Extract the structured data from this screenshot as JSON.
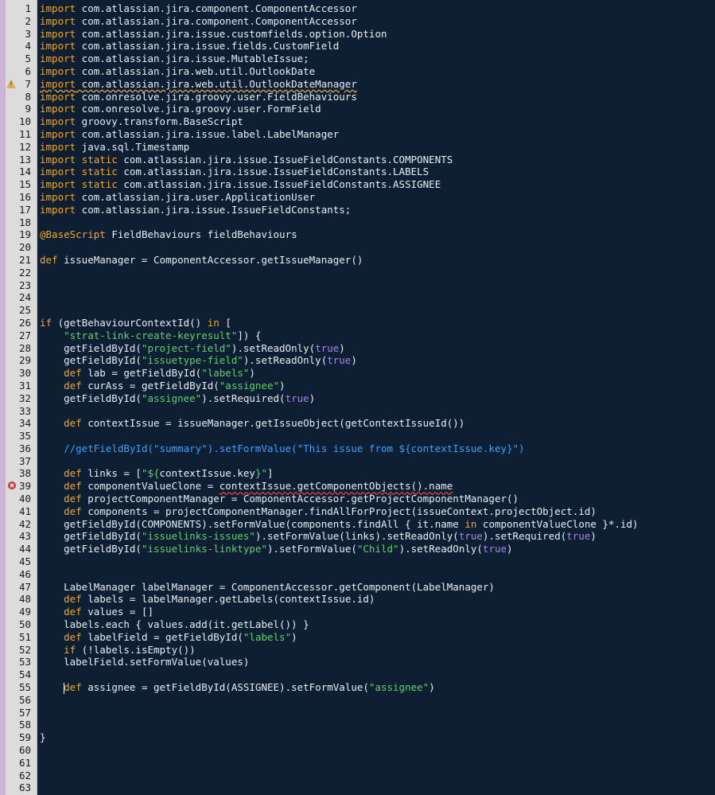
{
  "editor": {
    "background": "#0f1f33",
    "gutter_color": "#dcdcdc",
    "warning_line": 7,
    "error_line": 39,
    "cursor_line": 55
  },
  "lines": [
    {
      "n": "1",
      "t": [
        {
          "c": "kw",
          "s": "import"
        },
        {
          "s": " com.atlassian.jira.component.ComponentAccessor"
        }
      ]
    },
    {
      "n": "2",
      "t": [
        {
          "c": "kw",
          "s": "import"
        },
        {
          "s": " com.atlassian.jira.component.ComponentAccessor"
        }
      ]
    },
    {
      "n": "3",
      "t": [
        {
          "c": "kw",
          "s": "import"
        },
        {
          "s": " com.atlassian.jira.issue.customfields.option.Option"
        }
      ]
    },
    {
      "n": "4",
      "t": [
        {
          "c": "kw",
          "s": "import"
        },
        {
          "s": " com.atlassian.jira.issue.fields.CustomField"
        }
      ]
    },
    {
      "n": "5",
      "t": [
        {
          "c": "kw",
          "s": "import"
        },
        {
          "s": " com.atlassian.jira.issue.MutableIssue;"
        }
      ]
    },
    {
      "n": "6",
      "t": [
        {
          "c": "kw",
          "s": "import"
        },
        {
          "s": " com.atlassian.jira.web.util.OutlookDate"
        }
      ]
    },
    {
      "n": "7",
      "t": [
        {
          "c": "kw squiggle-warn",
          "s": "import"
        },
        {
          "c": "squiggle-warn",
          "s": " com.atlassian.jira.web.util.OutlookDateManager"
        }
      ]
    },
    {
      "n": "8",
      "t": [
        {
          "c": "kw",
          "s": "import"
        },
        {
          "s": " com.onresolve.jira.groovy.user.FieldBehaviours"
        }
      ]
    },
    {
      "n": "9",
      "t": [
        {
          "c": "kw",
          "s": "import"
        },
        {
          "s": " com.onresolve.jira.groovy.user.FormField"
        }
      ]
    },
    {
      "n": "10",
      "t": [
        {
          "c": "kw",
          "s": "import"
        },
        {
          "s": " groovy.transform.BaseScript"
        }
      ]
    },
    {
      "n": "11",
      "t": [
        {
          "c": "kw",
          "s": "import"
        },
        {
          "s": " com.atlassian.jira.issue.label.LabelManager"
        }
      ]
    },
    {
      "n": "12",
      "t": [
        {
          "c": "kw",
          "s": "import"
        },
        {
          "s": " java.sql.Timestamp"
        }
      ]
    },
    {
      "n": "13",
      "t": [
        {
          "c": "kw",
          "s": "import static"
        },
        {
          "s": " com.atlassian.jira.issue.IssueFieldConstants.COMPONENTS"
        }
      ]
    },
    {
      "n": "14",
      "t": [
        {
          "c": "kw",
          "s": "import static"
        },
        {
          "s": " com.atlassian.jira.issue.IssueFieldConstants.LABELS"
        }
      ]
    },
    {
      "n": "15",
      "t": [
        {
          "c": "kw",
          "s": "import static"
        },
        {
          "s": " com.atlassian.jira.issue.IssueFieldConstants.ASSIGNEE"
        }
      ]
    },
    {
      "n": "16",
      "t": [
        {
          "c": "kw",
          "s": "import"
        },
        {
          "s": " com.atlassian.jira.user.ApplicationUser"
        }
      ]
    },
    {
      "n": "17",
      "t": [
        {
          "c": "kw",
          "s": "import"
        },
        {
          "s": " com.atlassian.jira.issue.IssueFieldConstants;"
        }
      ]
    },
    {
      "n": "18",
      "t": []
    },
    {
      "n": "19",
      "t": [
        {
          "c": "ann",
          "s": "@BaseScript"
        },
        {
          "s": " FieldBehaviours fieldBehaviours"
        }
      ]
    },
    {
      "n": "20",
      "t": []
    },
    {
      "n": "21",
      "t": [
        {
          "c": "kw",
          "s": "def"
        },
        {
          "s": " issueManager = ComponentAccessor.getIssueManager()"
        }
      ]
    },
    {
      "n": "22",
      "t": []
    },
    {
      "n": "23",
      "t": []
    },
    {
      "n": "24",
      "t": []
    },
    {
      "n": "25",
      "t": []
    },
    {
      "n": "26",
      "t": [
        {
          "c": "kw",
          "s": "if"
        },
        {
          "s": " (getBehaviourContextId() "
        },
        {
          "c": "kw",
          "s": "in"
        },
        {
          "s": " ["
        }
      ]
    },
    {
      "n": "27",
      "t": [
        {
          "s": "    "
        },
        {
          "c": "str",
          "s": "\"strat-link-create-keyresult\""
        },
        {
          "s": "]) {"
        }
      ]
    },
    {
      "n": "28",
      "t": [
        {
          "s": "    getFieldById("
        },
        {
          "c": "str",
          "s": "\"project-field\""
        },
        {
          "s": ").setReadOnly("
        },
        {
          "c": "bool",
          "s": "true"
        },
        {
          "s": ")"
        }
      ]
    },
    {
      "n": "29",
      "t": [
        {
          "s": "    getFieldById("
        },
        {
          "c": "str",
          "s": "\"issuetype-field\""
        },
        {
          "s": ").setReadOnly("
        },
        {
          "c": "bool",
          "s": "true"
        },
        {
          "s": ")"
        }
      ]
    },
    {
      "n": "30",
      "t": [
        {
          "s": "    "
        },
        {
          "c": "kw",
          "s": "def"
        },
        {
          "s": " lab = getFieldById("
        },
        {
          "c": "str",
          "s": "\"labels\""
        },
        {
          "s": ")"
        }
      ]
    },
    {
      "n": "31",
      "t": [
        {
          "s": "    "
        },
        {
          "c": "kw",
          "s": "def"
        },
        {
          "s": " curAss = getFieldById("
        },
        {
          "c": "str",
          "s": "\"assignee\""
        },
        {
          "s": ")"
        }
      ]
    },
    {
      "n": "32",
      "t": [
        {
          "s": "    getFieldById("
        },
        {
          "c": "str",
          "s": "\"assignee\""
        },
        {
          "s": ").setRequired("
        },
        {
          "c": "bool",
          "s": "true"
        },
        {
          "s": ")"
        }
      ]
    },
    {
      "n": "33",
      "t": []
    },
    {
      "n": "34",
      "t": [
        {
          "s": "    "
        },
        {
          "c": "kw",
          "s": "def"
        },
        {
          "s": " contextIssue = issueManager.getIssueObject(getContextIssueId())"
        }
      ]
    },
    {
      "n": "35",
      "t": []
    },
    {
      "n": "36",
      "t": [
        {
          "s": "    "
        },
        {
          "c": "cm",
          "s": "//getFieldById(\"summary\").setFormValue(\"This issue from ${contextIssue.key}\")"
        }
      ]
    },
    {
      "n": "37",
      "t": []
    },
    {
      "n": "38",
      "t": [
        {
          "s": "    "
        },
        {
          "c": "kw",
          "s": "def"
        },
        {
          "s": " links = ["
        },
        {
          "c": "str",
          "s": "\"${"
        },
        {
          "s": "contextIssue.key"
        },
        {
          "c": "str",
          "s": "}\""
        },
        {
          "s": "]"
        }
      ]
    },
    {
      "n": "39",
      "t": [
        {
          "s": "    "
        },
        {
          "c": "kw",
          "s": "def"
        },
        {
          "s": " componentValueClone = "
        },
        {
          "c": "squiggle-err",
          "s": "contextIssue.getComponentObjects().name"
        }
      ]
    },
    {
      "n": "40",
      "t": [
        {
          "s": "    "
        },
        {
          "c": "kw",
          "s": "def"
        },
        {
          "s": " projectComponentManager = ComponentAccessor.getProjectComponentManager()"
        }
      ]
    },
    {
      "n": "41",
      "t": [
        {
          "s": "    "
        },
        {
          "c": "kw",
          "s": "def"
        },
        {
          "s": " components = projectComponentManager.findAllForProject(issueContext.projectObject.id)"
        }
      ]
    },
    {
      "n": "42",
      "t": [
        {
          "s": "    getFieldById(COMPONENTS).setFormValue(components.findAll { it.name "
        },
        {
          "c": "kw",
          "s": "in"
        },
        {
          "s": " componentValueClone }*.id)"
        }
      ]
    },
    {
      "n": "43",
      "t": [
        {
          "s": "    getFieldById("
        },
        {
          "c": "str",
          "s": "\"issuelinks-issues\""
        },
        {
          "s": ").setFormValue(links).setReadOnly("
        },
        {
          "c": "bool",
          "s": "true"
        },
        {
          "s": ").setRequired("
        },
        {
          "c": "bool",
          "s": "true"
        },
        {
          "s": ")"
        }
      ]
    },
    {
      "n": "44",
      "t": [
        {
          "s": "    getFieldById("
        },
        {
          "c": "str",
          "s": "\"issuelinks-linktype\""
        },
        {
          "s": ").setFormValue("
        },
        {
          "c": "str",
          "s": "\"Child\""
        },
        {
          "s": ").setReadOnly("
        },
        {
          "c": "bool",
          "s": "true"
        },
        {
          "s": ")"
        }
      ]
    },
    {
      "n": "45",
      "t": []
    },
    {
      "n": "46",
      "t": []
    },
    {
      "n": "47",
      "t": [
        {
          "s": "    LabelManager labelManager = ComponentAccessor.getComponent(LabelManager)"
        }
      ]
    },
    {
      "n": "48",
      "t": [
        {
          "s": "    "
        },
        {
          "c": "kw",
          "s": "def"
        },
        {
          "s": " labels = labelManager.getLabels(contextIssue.id)"
        }
      ]
    },
    {
      "n": "49",
      "t": [
        {
          "s": "    "
        },
        {
          "c": "kw",
          "s": "def"
        },
        {
          "s": " values = []"
        }
      ]
    },
    {
      "n": "50",
      "t": [
        {
          "s": "    labels.each { values.add(it.getLabel()) }"
        }
      ]
    },
    {
      "n": "51",
      "t": [
        {
          "s": "    "
        },
        {
          "c": "kw",
          "s": "def"
        },
        {
          "s": " labelField = getFieldById("
        },
        {
          "c": "str",
          "s": "\"labels\""
        },
        {
          "s": ")"
        }
      ]
    },
    {
      "n": "52",
      "t": [
        {
          "s": "    "
        },
        {
          "c": "kw",
          "s": "if"
        },
        {
          "s": " (!labels.isEmpty())"
        }
      ]
    },
    {
      "n": "53",
      "t": [
        {
          "s": "    labelField.setFormValue(values)"
        }
      ]
    },
    {
      "n": "54",
      "t": []
    },
    {
      "n": "55",
      "t": [
        {
          "s": "    "
        },
        {
          "c": "cursor",
          "s": ""
        },
        {
          "c": "kw",
          "s": "def"
        },
        {
          "s": " assignee = getFieldById(ASSIGNEE).setFormValue("
        },
        {
          "c": "str",
          "s": "\"assignee\""
        },
        {
          "s": ")"
        }
      ]
    },
    {
      "n": "56",
      "t": []
    },
    {
      "n": "57",
      "t": []
    },
    {
      "n": "58",
      "t": []
    },
    {
      "n": "59",
      "t": [
        {
          "s": "}"
        }
      ]
    },
    {
      "n": "60",
      "t": []
    },
    {
      "n": "61",
      "t": []
    },
    {
      "n": "62",
      "t": []
    },
    {
      "n": "63",
      "t": []
    }
  ]
}
